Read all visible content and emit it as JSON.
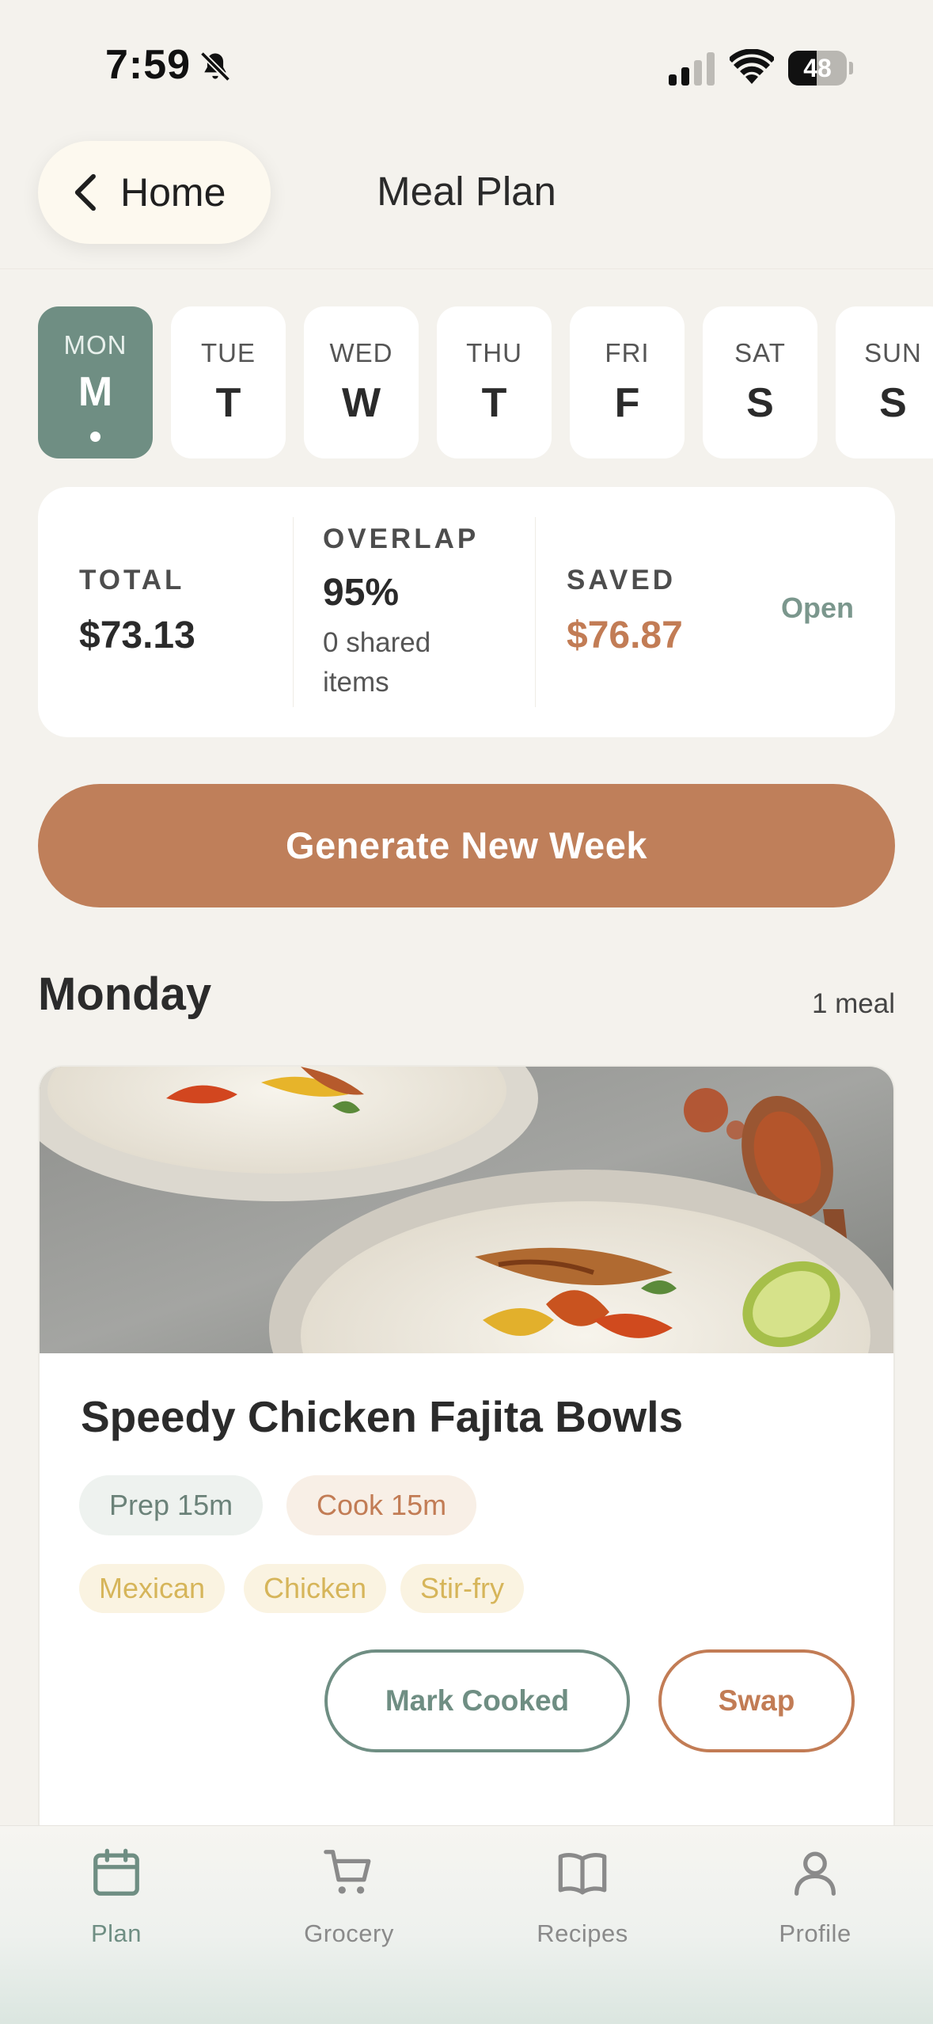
{
  "status_bar": {
    "time": "7:59",
    "battery_level": "48",
    "battery_fraction": 0.48,
    "icons": [
      "bell-slash-icon",
      "signal-icon",
      "wifi-icon",
      "battery-icon"
    ]
  },
  "header": {
    "back_label": "Home",
    "title": "Meal Plan"
  },
  "days": [
    {
      "abbr": "MON",
      "letter": "M",
      "active": true,
      "has_meal_dot": true
    },
    {
      "abbr": "TUE",
      "letter": "T",
      "active": false
    },
    {
      "abbr": "WED",
      "letter": "W",
      "active": false
    },
    {
      "abbr": "THU",
      "letter": "T",
      "active": false
    },
    {
      "abbr": "FRI",
      "letter": "F",
      "active": false
    },
    {
      "abbr": "SAT",
      "letter": "S",
      "active": false
    },
    {
      "abbr": "SUN",
      "letter": "S",
      "active": false
    }
  ],
  "summary": {
    "total_label": "TOTAL",
    "total_value": "$73.13",
    "overlap_label": "OVERLAP",
    "overlap_value": "95%",
    "overlap_sub": "0 shared items",
    "saved_label": "SAVED",
    "saved_value": "$76.87",
    "open_label": "Open"
  },
  "generate_label": "Generate New Week",
  "section": {
    "title": "Monday",
    "count": "1 meal"
  },
  "meal": {
    "title": "Speedy Chicken Fajita Bowls",
    "prep": "Prep 15m",
    "cook": "Cook 15m",
    "tags": [
      "Mexican",
      "Chicken",
      "Stir-fry"
    ],
    "mark_cooked_label": "Mark Cooked",
    "swap_label": "Swap"
  },
  "tabs": [
    {
      "label": "Plan",
      "icon": "calendar-icon",
      "active": true
    },
    {
      "label": "Grocery",
      "icon": "cart-icon",
      "active": false
    },
    {
      "label": "Recipes",
      "icon": "book-icon",
      "active": false
    },
    {
      "label": "Profile",
      "icon": "person-icon",
      "active": false
    }
  ],
  "colors": {
    "background": "#f4f2ed",
    "sage": "#6f8e83",
    "terracotta": "#bf7f5a",
    "tag_gold": "#d6b55a"
  }
}
